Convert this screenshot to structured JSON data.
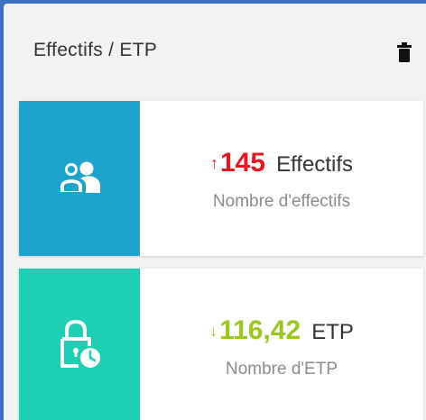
{
  "widget": {
    "title": "Effectifs / ETP",
    "delete_icon": "trash-icon"
  },
  "cards": [
    {
      "icon": "users-icon",
      "icon_bg_color": "#1ea3cc",
      "trend": "up",
      "trend_arrow": "↑",
      "trend_color": "#e8171f",
      "value": "145",
      "unit": "Effectifs",
      "subtitle": "Nombre d'effectifs"
    },
    {
      "icon": "lock-clock-icon",
      "icon_bg_color": "#1fcfb4",
      "trend": "down",
      "trend_arrow": "↓",
      "trend_color": "#9bc61f",
      "value": "116,42",
      "unit": "ETP",
      "subtitle": "Nombre d'ETP"
    }
  ]
}
